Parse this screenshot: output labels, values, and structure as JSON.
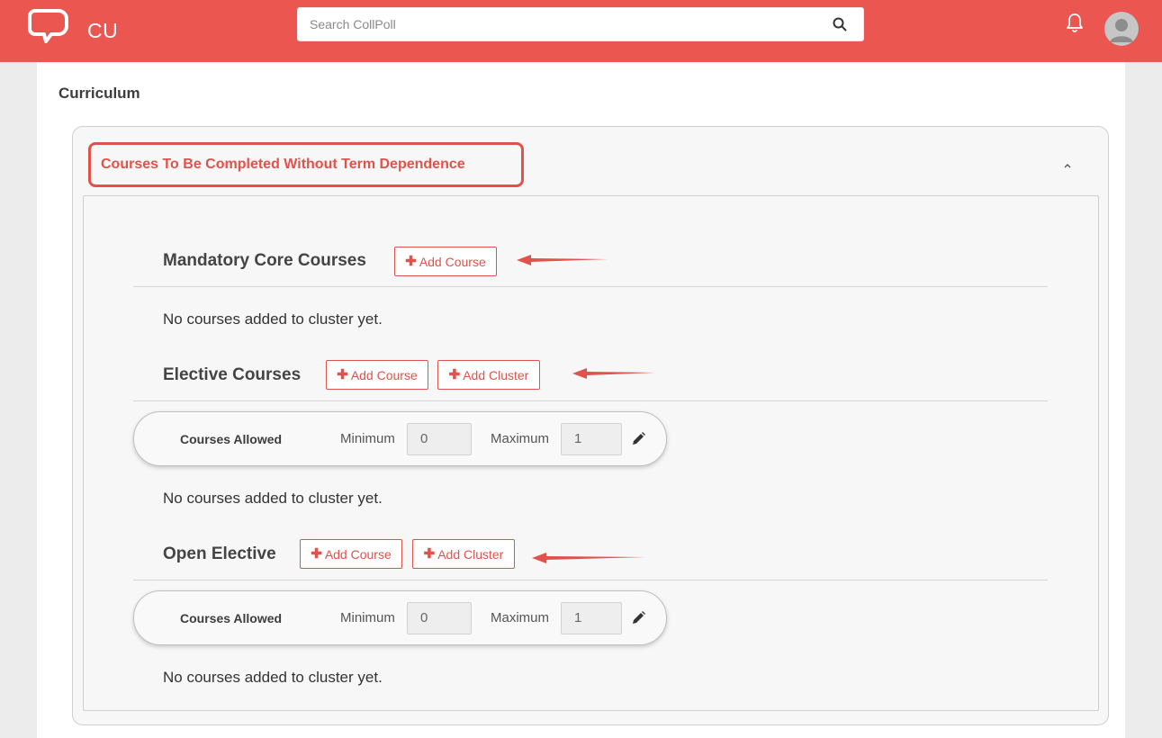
{
  "header": {
    "brand": "CU",
    "search_placeholder": "Search CollPoll",
    "icons": [
      "collpoll-logo-icon",
      "search-icon",
      "bell-icon",
      "avatar"
    ],
    "brand_color": "#eb5651"
  },
  "page": {
    "title": "Curriculum"
  },
  "accordion": {
    "title": "Courses To Be Completed Without Term Dependence",
    "expanded": true,
    "accent_color": "#e0524c"
  },
  "sections": [
    {
      "title": "Mandatory Core Courses",
      "buttons": [
        "Add Course"
      ],
      "empty_text": "No courses added to cluster yet."
    },
    {
      "title": "Elective Courses",
      "buttons": [
        "Add Course",
        "Add Cluster"
      ],
      "courses_allowed": {
        "label": "Courses Allowed",
        "min_label": "Minimum",
        "min": "0",
        "max_label": "Maximum",
        "max": "1"
      },
      "empty_text": "No courses added to cluster yet."
    },
    {
      "title": "Open Elective",
      "buttons": [
        "Add Course",
        "Add Cluster"
      ],
      "courses_allowed": {
        "label": "Courses Allowed",
        "min_label": "Minimum",
        "min": "0",
        "max_label": "Maximum",
        "max": "1"
      },
      "empty_text": "No courses added to cluster yet."
    }
  ]
}
